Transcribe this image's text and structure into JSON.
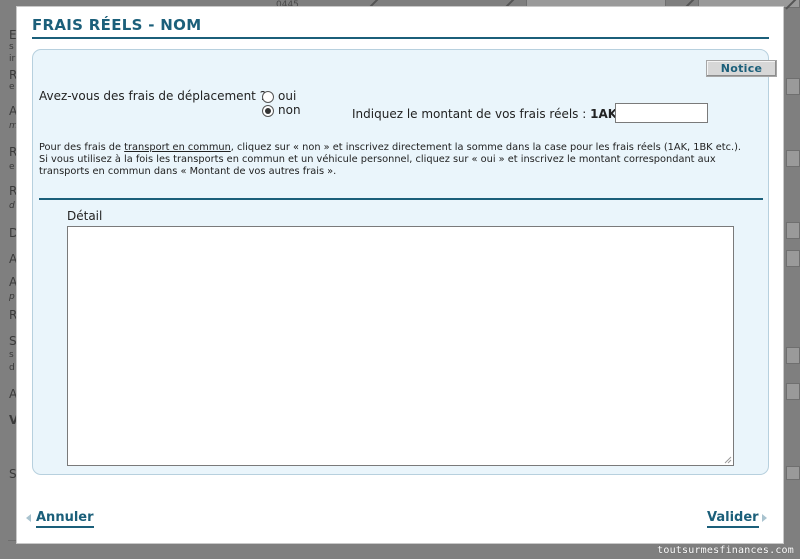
{
  "modal": {
    "title": "FRAIS RÉELS - NOM",
    "notice_label": "Notice",
    "question": "Avez-vous des frais de déplacement ?",
    "options": [
      {
        "label": "oui",
        "checked": false
      },
      {
        "label": "non",
        "checked": true
      }
    ],
    "amount_label": "Indiquez le montant de vos frais réels :",
    "amount_code": "1AK",
    "amount_value": "",
    "info": {
      "line1_prefix": "Pour des frais de",
      "line1_link": "transport en commun",
      "line1_suffix": ", cliquez sur « non » et inscrivez directement la somme dans la case pour les frais réels (1AK, 1BK etc.).",
      "line2": "Si vous utilisez à la fois les transports en commun et un véhicule personnel, cliquez sur « oui » et inscrivez le montant correspondant aux transports en commun dans « Montant de vos autres frais »."
    },
    "detail_label": "Détail",
    "detail_value": "",
    "cancel_label": "Annuler",
    "validate_label": "Valider"
  },
  "background": {
    "top_text": "0445",
    "left_letters": [
      "E",
      "s",
      "ir",
      "R",
      "e",
      "A",
      "m",
      "R",
      "e",
      "R",
      "d",
      "D",
      "A",
      "A",
      "p",
      "R",
      "S",
      "s",
      "d",
      "A",
      "V",
      "S"
    ]
  },
  "watermark": "toutsurmesfinances.com",
  "colors": {
    "accent": "#1b5f7a",
    "panel_bg": "#eaf5fb",
    "panel_border": "#b7d0de"
  }
}
